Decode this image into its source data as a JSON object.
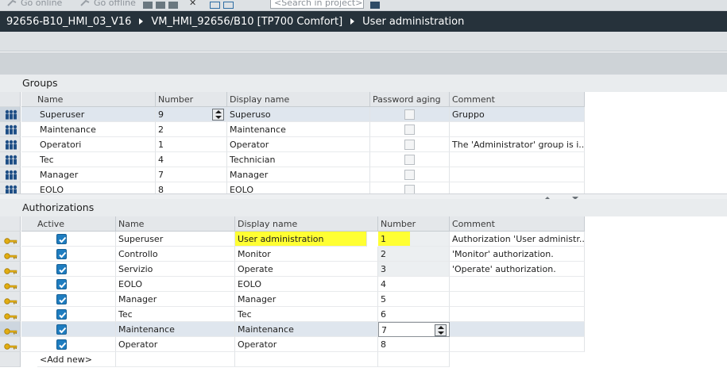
{
  "toolbar": {
    "go_online": "Go online",
    "go_offline": "Go offline",
    "search_placeholder": "<Search in project>"
  },
  "breadcrumb": [
    "92656-B10_HMI_03_V16",
    "VM_HMI_92656/B10 [TP700 Comfort]",
    "User administration"
  ],
  "groups": {
    "title": "Groups",
    "columns": [
      "Name",
      "Number",
      "Display name",
      "Password aging",
      "Comment"
    ],
    "rows": [
      {
        "name": "Superuser",
        "number": "9",
        "display": "Superuso",
        "comment": "Gruppo"
      },
      {
        "name": "Maintenance",
        "number": "2",
        "display": "Maintenance",
        "comment": ""
      },
      {
        "name": "Operatori",
        "number": "1",
        "display": "Operator",
        "comment": "The 'Administrator' group is i..."
      },
      {
        "name": "Tec",
        "number": "4",
        "display": "Technician",
        "comment": ""
      },
      {
        "name": "Manager",
        "number": "7",
        "display": "Manager",
        "comment": ""
      },
      {
        "name": "EOLO",
        "number": "8",
        "display": "EOLO",
        "comment": ""
      }
    ]
  },
  "authorizations": {
    "title": "Authorizations",
    "columns": [
      "Active",
      "Name",
      "Display name",
      "Number",
      "Comment"
    ],
    "rows": [
      {
        "name": "Superuser",
        "display": "User administration",
        "number": "1",
        "comment": "Authorization 'User administr..."
      },
      {
        "name": "Controllo",
        "display": "Monitor",
        "number": "2",
        "comment": "'Monitor' authorization."
      },
      {
        "name": "Servizio",
        "display": "Operate",
        "number": "3",
        "comment": "'Operate' authorization."
      },
      {
        "name": "EOLO",
        "display": "EOLO",
        "number": "4",
        "comment": ""
      },
      {
        "name": "Manager",
        "display": "Manager",
        "number": "5",
        "comment": ""
      },
      {
        "name": "Tec",
        "display": "Tec",
        "number": "6",
        "comment": ""
      },
      {
        "name": "Maintenance",
        "display": "Maintenance",
        "number": "7",
        "comment": ""
      },
      {
        "name": "Operator",
        "display": "Operator",
        "number": "8",
        "comment": ""
      }
    ],
    "add_new": "<Add new>"
  },
  "colors": {
    "breadcrumb_bg": "#26323b",
    "checkbox_on": "#1f7dc0",
    "highlight": "#ffff33"
  }
}
